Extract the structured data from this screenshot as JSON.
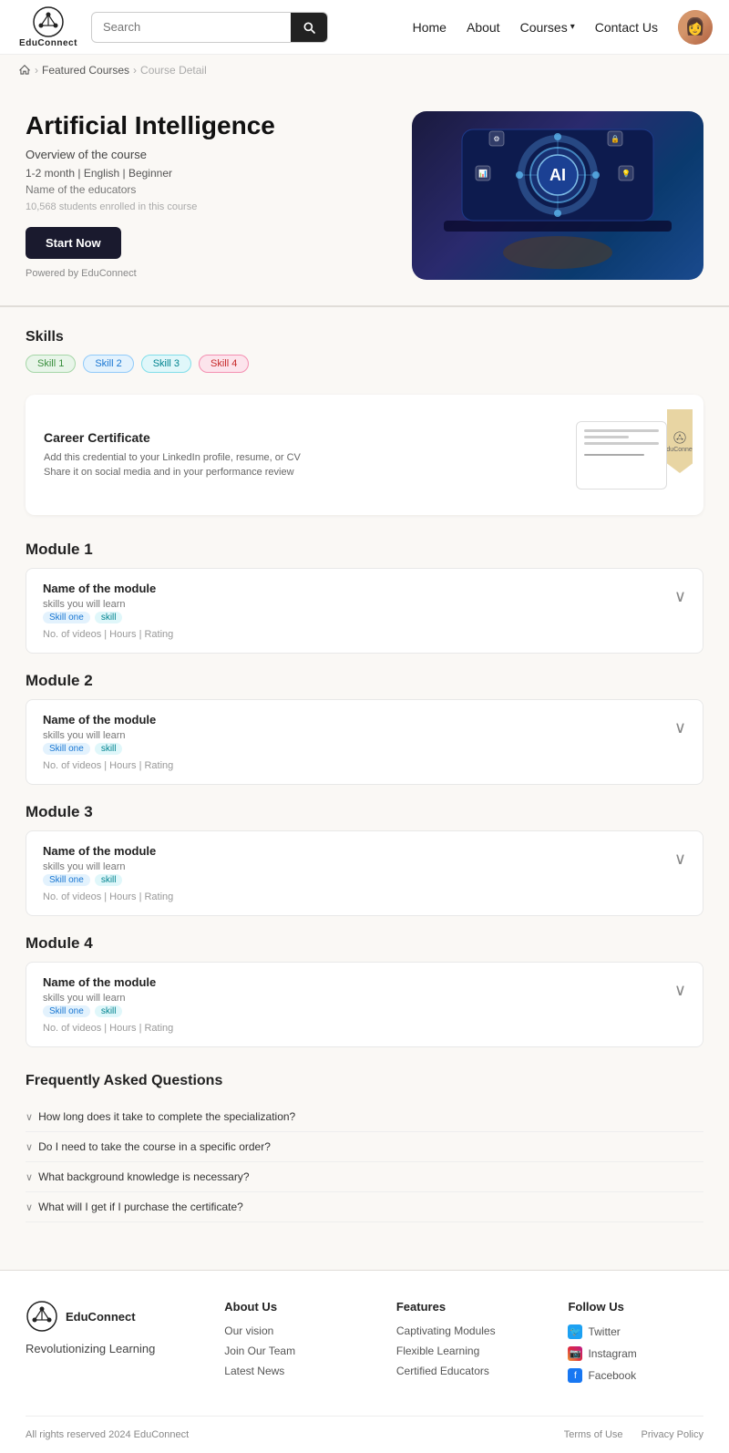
{
  "navbar": {
    "logo_text": "EduConnect",
    "search_placeholder": "Search",
    "nav_items": [
      "Home",
      "About",
      "Courses",
      "Contact Us"
    ],
    "courses_has_dropdown": true
  },
  "breadcrumb": {
    "home": "Home",
    "featured": "Featured Courses",
    "current": "Course Detail"
  },
  "hero": {
    "title": "Artificial Intelligence",
    "subtitle": "Overview of the course",
    "meta": "1-2 month | English | Beginner",
    "educators_label": "Name of the educators",
    "enrolled": "10,568 students enrolled in this course",
    "start_button": "Start Now",
    "powered_by": "Powered by EduConnect"
  },
  "skills": {
    "section_title": "Skills",
    "tags": [
      {
        "label": "Skill 1",
        "color": "green"
      },
      {
        "label": "Skill 2",
        "color": "blue"
      },
      {
        "label": "Skill 3",
        "color": "teal"
      },
      {
        "label": "Skill 4",
        "color": "red"
      }
    ]
  },
  "certificate": {
    "title": "Career Certificate",
    "line1": "Add this credential to your LinkedIn profile, resume, or CV",
    "line2": "Share it on social media and in your performance review",
    "logo_small": "EduConnect"
  },
  "modules": [
    {
      "title": "Module 1",
      "card_title": "Name of the module",
      "skills_label": "skills you will learn",
      "skill_tags": [
        "Skill one",
        "skill"
      ],
      "meta": "No. of videos | Hours | Rating"
    },
    {
      "title": "Module 2",
      "card_title": "Name of the module",
      "skills_label": "skills you will learn",
      "skill_tags": [
        "Skill one",
        "skill"
      ],
      "meta": "No. of videos | Hours | Rating"
    },
    {
      "title": "Module 3",
      "card_title": "Name of the module",
      "skills_label": "skills you will learn",
      "skill_tags": [
        "Skill one",
        "skill"
      ],
      "meta": "No. of videos | Hours | Rating"
    },
    {
      "title": "Module 4",
      "card_title": "Name of the module",
      "skills_label": "skills you will learn",
      "skill_tags": [
        "Skill one",
        "skill"
      ],
      "meta": "No. of videos | Hours | Rating"
    }
  ],
  "faq": {
    "title": "Frequently Asked Questions",
    "items": [
      "How long does it take to complete the specialization?",
      "Do I need to take the course in a specific order?",
      "What background knowledge is necessary?",
      "What will I get if I purchase the certificate?"
    ]
  },
  "footer": {
    "logo_text": "EduConnect",
    "tagline": "Revolutionizing Learning",
    "about_title": "About Us",
    "about_links": [
      "Our vision",
      "Join Our Team",
      "Latest News"
    ],
    "features_title": "Features",
    "features_links": [
      "Captivating Modules",
      "Flexible Learning",
      "Certified Educators"
    ],
    "follow_title": "Follow Us",
    "social_links": [
      {
        "label": "Twitter",
        "type": "twitter"
      },
      {
        "label": "Instagram",
        "type": "instagram"
      },
      {
        "label": "Facebook",
        "type": "facebook"
      }
    ],
    "copyright": "All rights reserved 2024 EduConnect",
    "bottom_links": [
      "Terms of Use",
      "Privacy Policy"
    ]
  }
}
